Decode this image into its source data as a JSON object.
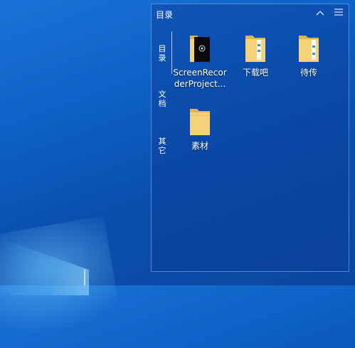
{
  "panel": {
    "title": "目录",
    "collapse_icon": "chevron-up-icon",
    "menu_icon": "hamburger-menu-icon"
  },
  "side_tabs": [
    {
      "label": "目录"
    },
    {
      "label": "文档"
    },
    {
      "label": "其它"
    }
  ],
  "items": [
    {
      "label": "ScreenRecorderProject...",
      "icon": "folder-app-icon"
    },
    {
      "label": "下载吧",
      "icon": "folder-icon"
    },
    {
      "label": "待传",
      "icon": "folder-icon"
    },
    {
      "label": "素材",
      "icon": "folder-icon"
    }
  ],
  "colors": {
    "folder": "#f4d27a",
    "folder_dark": "#e2b54a",
    "panel_border": "#8cbeff"
  }
}
